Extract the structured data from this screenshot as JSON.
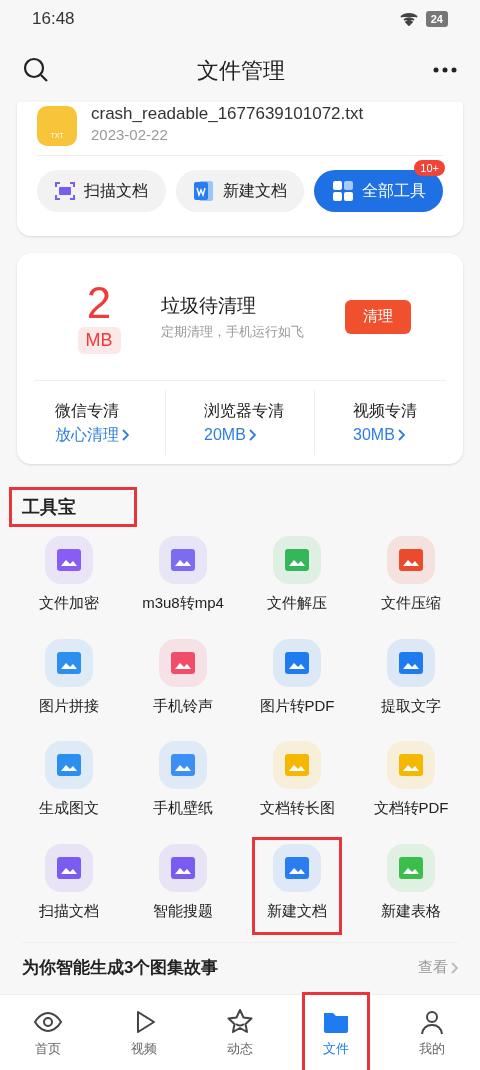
{
  "status_bar": {
    "time": "16:48",
    "battery": "24"
  },
  "header": {
    "title": "文件管理"
  },
  "recent_file": {
    "name": "crash_readable_1677639101072.txt",
    "date": "2023-02-22",
    "type_label": "TXT"
  },
  "quick_actions": [
    {
      "label": "扫描文档",
      "kind": "scan",
      "primary": false
    },
    {
      "label": "新建文档",
      "kind": "word",
      "primary": false
    },
    {
      "label": "全部工具",
      "kind": "grid",
      "primary": true,
      "badge": "10+"
    }
  ],
  "cleanup": {
    "amount": "2",
    "unit": "MB",
    "title": "垃圾待清理",
    "subtitle": "定期清理，手机运行如飞",
    "button": "清理",
    "items": [
      {
        "name": "微信专清",
        "value": "放心清理"
      },
      {
        "name": "浏览器专清",
        "value": "20MB"
      },
      {
        "name": "视频专清",
        "value": "30MB"
      }
    ]
  },
  "toolbox": {
    "title": "工具宝",
    "highlighted": true,
    "tools": [
      {
        "label": "文件加密",
        "color": "#8a5cf6",
        "highlighted": false
      },
      {
        "label": "m3u8转mp4",
        "color": "#7b6cf0",
        "highlighted": false
      },
      {
        "label": "文件解压",
        "color": "#34b75a",
        "highlighted": false
      },
      {
        "label": "文件压缩",
        "color": "#e94b2c",
        "highlighted": false
      },
      {
        "label": "图片拼接",
        "color": "#2b8ff0",
        "highlighted": false
      },
      {
        "label": "手机铃声",
        "color": "#ef4d6a",
        "highlighted": false
      },
      {
        "label": "图片转PDF",
        "color": "#1f7cf0",
        "highlighted": false
      },
      {
        "label": "提取文字",
        "color": "#1f7cf0",
        "highlighted": false
      },
      {
        "label": "生成图文",
        "color": "#2b8ff0",
        "highlighted": false
      },
      {
        "label": "手机壁纸",
        "color": "#3d8ef5",
        "highlighted": false
      },
      {
        "label": "文档转长图",
        "color": "#f5b800",
        "highlighted": false
      },
      {
        "label": "文档转PDF",
        "color": "#f5b800",
        "highlighted": false
      },
      {
        "label": "扫描文档",
        "color": "#7b5cf0",
        "highlighted": false
      },
      {
        "label": "智能搜题",
        "color": "#7b5cf0",
        "highlighted": false
      },
      {
        "label": "新建文档",
        "color": "#2a7df0",
        "highlighted": true
      },
      {
        "label": "新建表格",
        "color": "#3cbf4a",
        "highlighted": false
      }
    ]
  },
  "story": {
    "title": "为你智能生成3个图集故事",
    "link": "查看"
  },
  "tab_bar": [
    {
      "label": "首页",
      "kind": "eye",
      "selected": false,
      "highlighted": false
    },
    {
      "label": "视频",
      "kind": "play",
      "selected": false,
      "highlighted": false
    },
    {
      "label": "动态",
      "kind": "star",
      "selected": false,
      "highlighted": false
    },
    {
      "label": "文件",
      "kind": "folder",
      "selected": true,
      "highlighted": true
    },
    {
      "label": "我的",
      "kind": "person",
      "selected": false,
      "highlighted": false
    }
  ]
}
